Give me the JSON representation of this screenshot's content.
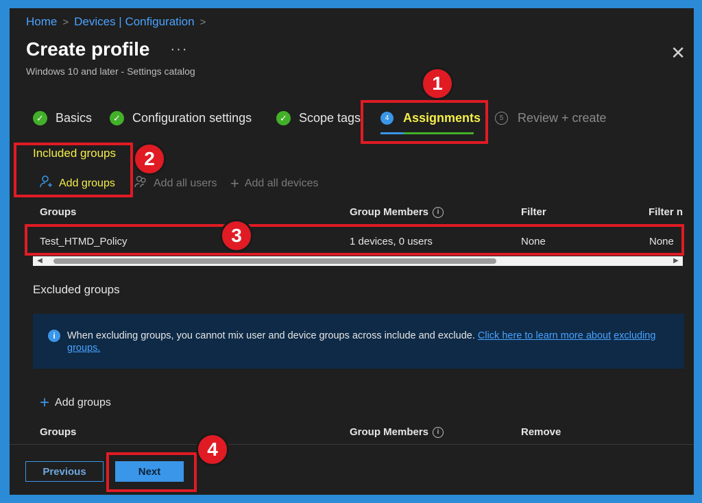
{
  "breadcrumb": {
    "home": "Home",
    "devices": "Devices | Configuration"
  },
  "header": {
    "title": "Create profile",
    "more": "···",
    "subtitle": "Windows 10 and later - Settings catalog",
    "close": "✕"
  },
  "steps": [
    {
      "label": "Basics",
      "state": "done"
    },
    {
      "label": "Configuration settings",
      "state": "done"
    },
    {
      "label": "Scope tags",
      "state": "done"
    },
    {
      "label": "Assignments",
      "number": "4",
      "state": "active"
    },
    {
      "label": "Review + create",
      "number": "5",
      "state": "inactive"
    }
  ],
  "included": {
    "title": "Included groups",
    "actions": {
      "add_groups": "Add groups",
      "add_all_users": "Add all users",
      "add_all_devices": "Add all devices"
    },
    "columns": {
      "groups": "Groups",
      "members": "Group Members",
      "filter": "Filter",
      "filter_mode": "Filter n"
    },
    "rows": [
      {
        "group": "Test_HTMD_Policy",
        "members": "1 devices, 0 users",
        "filter": "None",
        "filter_mode": "None"
      }
    ]
  },
  "excluded": {
    "title": "Excluded groups",
    "info_text": "When excluding groups, you cannot mix user and device groups across include and exclude.",
    "info_link_1": "Click here to learn more about",
    "info_link_2": "excluding groups.",
    "add_groups": "Add groups",
    "columns": {
      "groups": "Groups",
      "members": "Group Members",
      "remove": "Remove"
    }
  },
  "footer": {
    "previous": "Previous",
    "next": "Next"
  },
  "annotations": {
    "b1": "1",
    "b2": "2",
    "b3": "3",
    "b4": "4"
  },
  "colors": {
    "accent": "#3a96e8",
    "highlight": "#e01b24",
    "active_step": "#f4ee4a",
    "success": "#43b02a"
  }
}
